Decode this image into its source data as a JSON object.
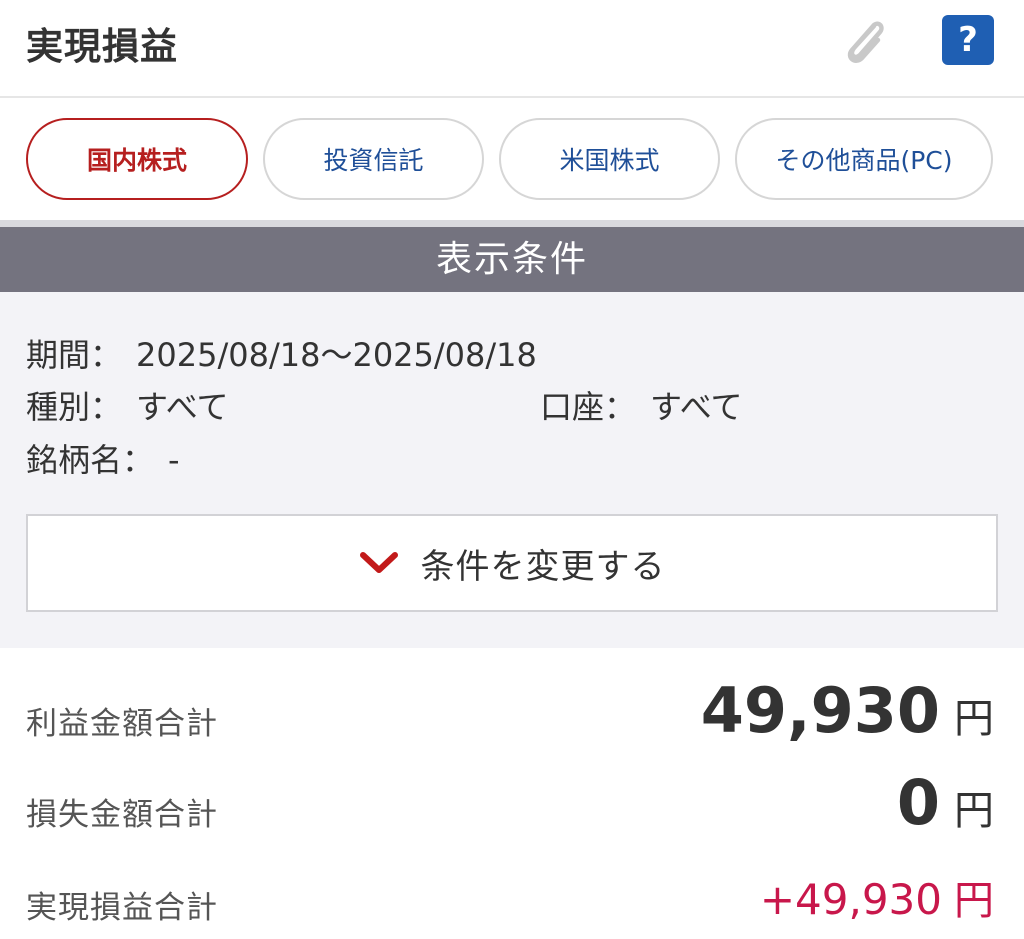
{
  "header": {
    "title": "実現損益",
    "attach_icon": "paperclip-icon",
    "help_label": "?"
  },
  "tabs": [
    {
      "label": "国内株式",
      "active": true
    },
    {
      "label": "投資信託",
      "active": false
    },
    {
      "label": "米国株式",
      "active": false
    },
    {
      "label": "その他商品(PC)",
      "active": false
    }
  ],
  "conditions": {
    "title": "表示条件",
    "period_label": "期間：",
    "period_value": "2025/08/18～2025/08/18",
    "type_label": "種別：",
    "type_value": "すべて",
    "account_label": "口座：",
    "account_value": "すべて",
    "name_label": "銘柄名：",
    "name_value": "-",
    "change_button": "条件を変更する",
    "change_icon": "chevron-down-icon"
  },
  "summary": {
    "profit_label": "利益金額合計",
    "profit_value": "49,930",
    "loss_label": "損失金額合計",
    "loss_value": "0",
    "realized_label": "実現損益合計",
    "realized_value": "+49,930",
    "unit": "円"
  },
  "colors": {
    "accent_red": "#b61f1f",
    "link_blue": "#1f4f98",
    "help_blue": "#1f5fb3",
    "gain_pink": "#c8174b",
    "section_gray": "#74737f"
  }
}
